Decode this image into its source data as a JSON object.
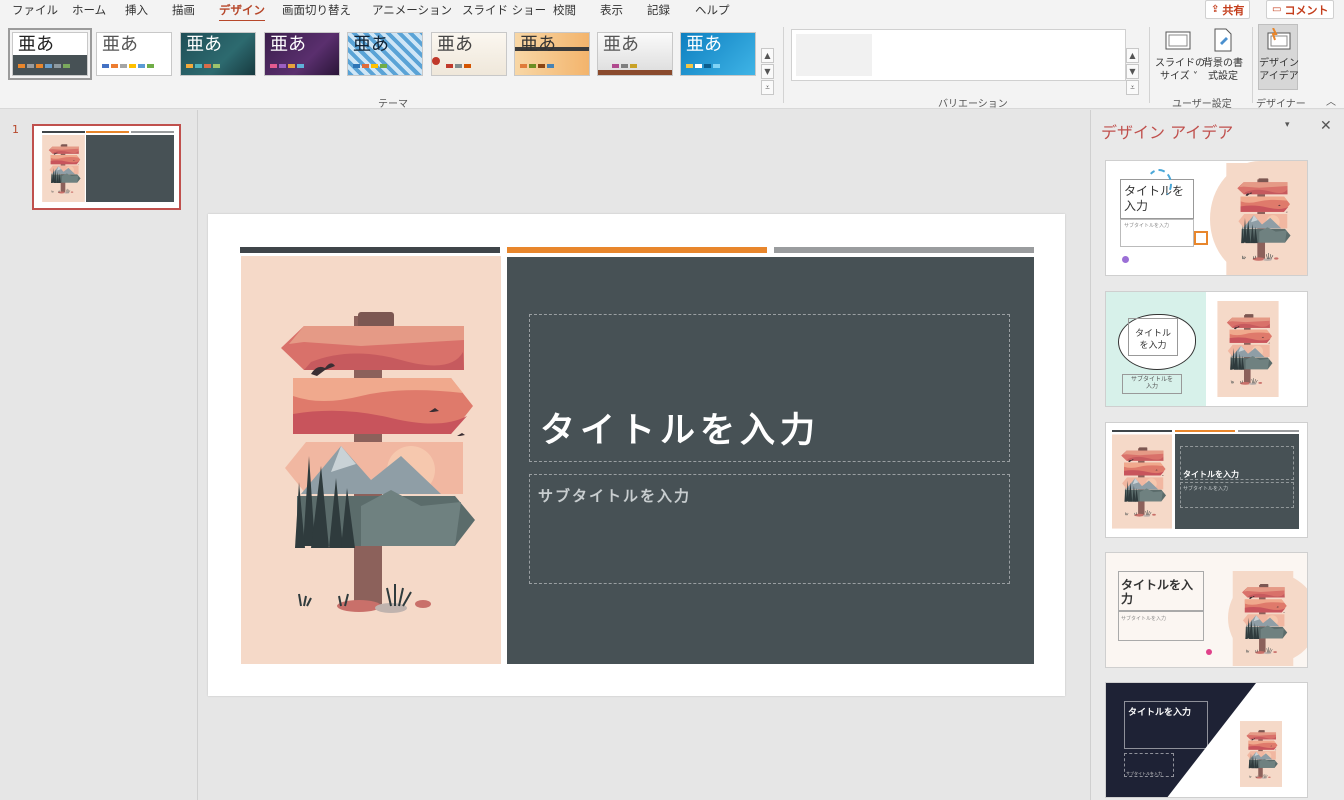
{
  "tabs": [
    "ファイル",
    "ホーム",
    "挿入",
    "描画",
    "デザイン",
    "画面切り替え",
    "アニメーション",
    "スライド ショー",
    "校閲",
    "表示",
    "記録",
    "ヘルプ"
  ],
  "active_tab": "デザイン",
  "share_label": "共有",
  "comment_label": "コメント",
  "themes": {
    "glyph": "亜あ",
    "group_label": "テーマ"
  },
  "variations": {
    "group_label": "バリエーション"
  },
  "customize": {
    "slide_size_label": "スライドの\nサイズ ˅",
    "format_bg_label": "背景の書\n式設定",
    "group_label": "ユーザー設定"
  },
  "designer_group": {
    "design_ideas_label": "デザイン\nアイデア",
    "group_label": "デザイナー"
  },
  "slide_pane": {
    "slide_number": "1"
  },
  "slide": {
    "title": "タイトルを入力",
    "subtitle": "サブタイトルを入力",
    "colors": {
      "panel": "#475155",
      "accent": "#e8862c",
      "left_bar": "#3f4549",
      "right_bar": "#9a9c9e",
      "illustration_bg": "#f5d9c8"
    }
  },
  "designer_pane": {
    "title": "デザイン アイデア",
    "ideas": [
      {
        "title": "タイトルを\n入力",
        "subtitle": "サブタイトルを入力"
      },
      {
        "title": "タイトル\nを入力",
        "subtitle": "サブタイトルを\n入力"
      },
      {
        "title": "タイトルを入力",
        "subtitle": "サブタイトルを入力"
      },
      {
        "title": "タイトルを入\n力",
        "subtitle": "サブタイトルを入力"
      },
      {
        "title": "タイトルを入力",
        "subtitle": "サブタイトルを入力"
      }
    ]
  }
}
